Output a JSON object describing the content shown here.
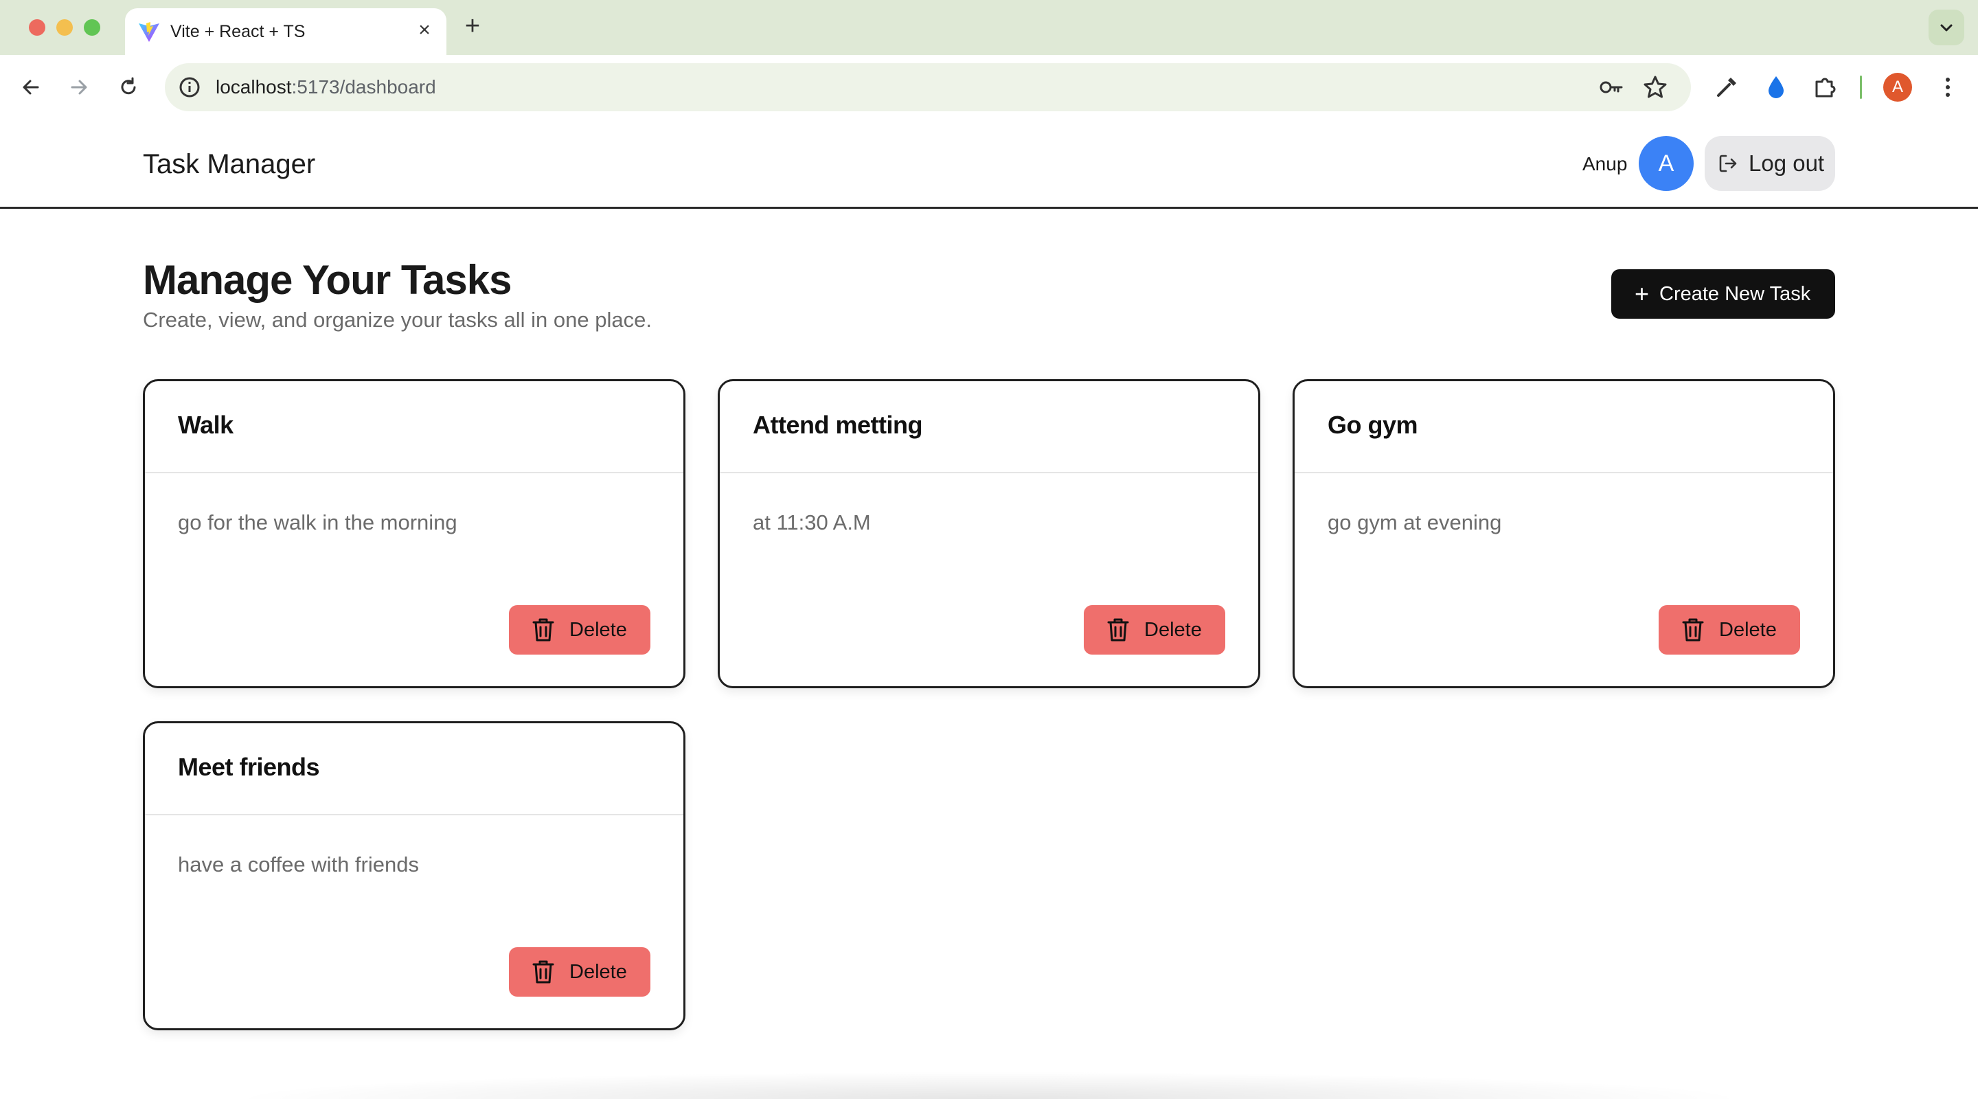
{
  "browser": {
    "tab_title": "Vite + React + TS",
    "url_host": "localhost",
    "url_path": ":5173/dashboard",
    "profile_initial": "A",
    "icons": [
      "back-icon",
      "forward-icon",
      "reload-icon",
      "site-info-icon",
      "password-key-icon",
      "bookmark-star-icon",
      "eyedropper-icon",
      "drop-extension-icon",
      "extensions-puzzle-icon",
      "more-menu-icon"
    ]
  },
  "header": {
    "brand": "Task Manager",
    "user_name": "Anup",
    "avatar_initial": "A",
    "logout_label": "Log out"
  },
  "main": {
    "title": "Manage Your Tasks",
    "subtitle": "Create, view, and organize your tasks all in one place.",
    "create_label": "Create New Task"
  },
  "tasks": [
    {
      "title": "Walk",
      "description": "go for the walk in the morning",
      "delete_label": "Delete"
    },
    {
      "title": "Attend metting",
      "description": "at 11:30 A.M",
      "delete_label": "Delete"
    },
    {
      "title": "Go gym",
      "description": "go gym at evening",
      "delete_label": "Delete"
    },
    {
      "title": "Meet friends",
      "description": "have a coffee with friends",
      "delete_label": "Delete"
    }
  ],
  "colors": {
    "chrome_bg": "#dfe9d6",
    "avatar": "#3b82f6",
    "primary_button": "#111111",
    "delete_button": "#ef6f6c"
  }
}
